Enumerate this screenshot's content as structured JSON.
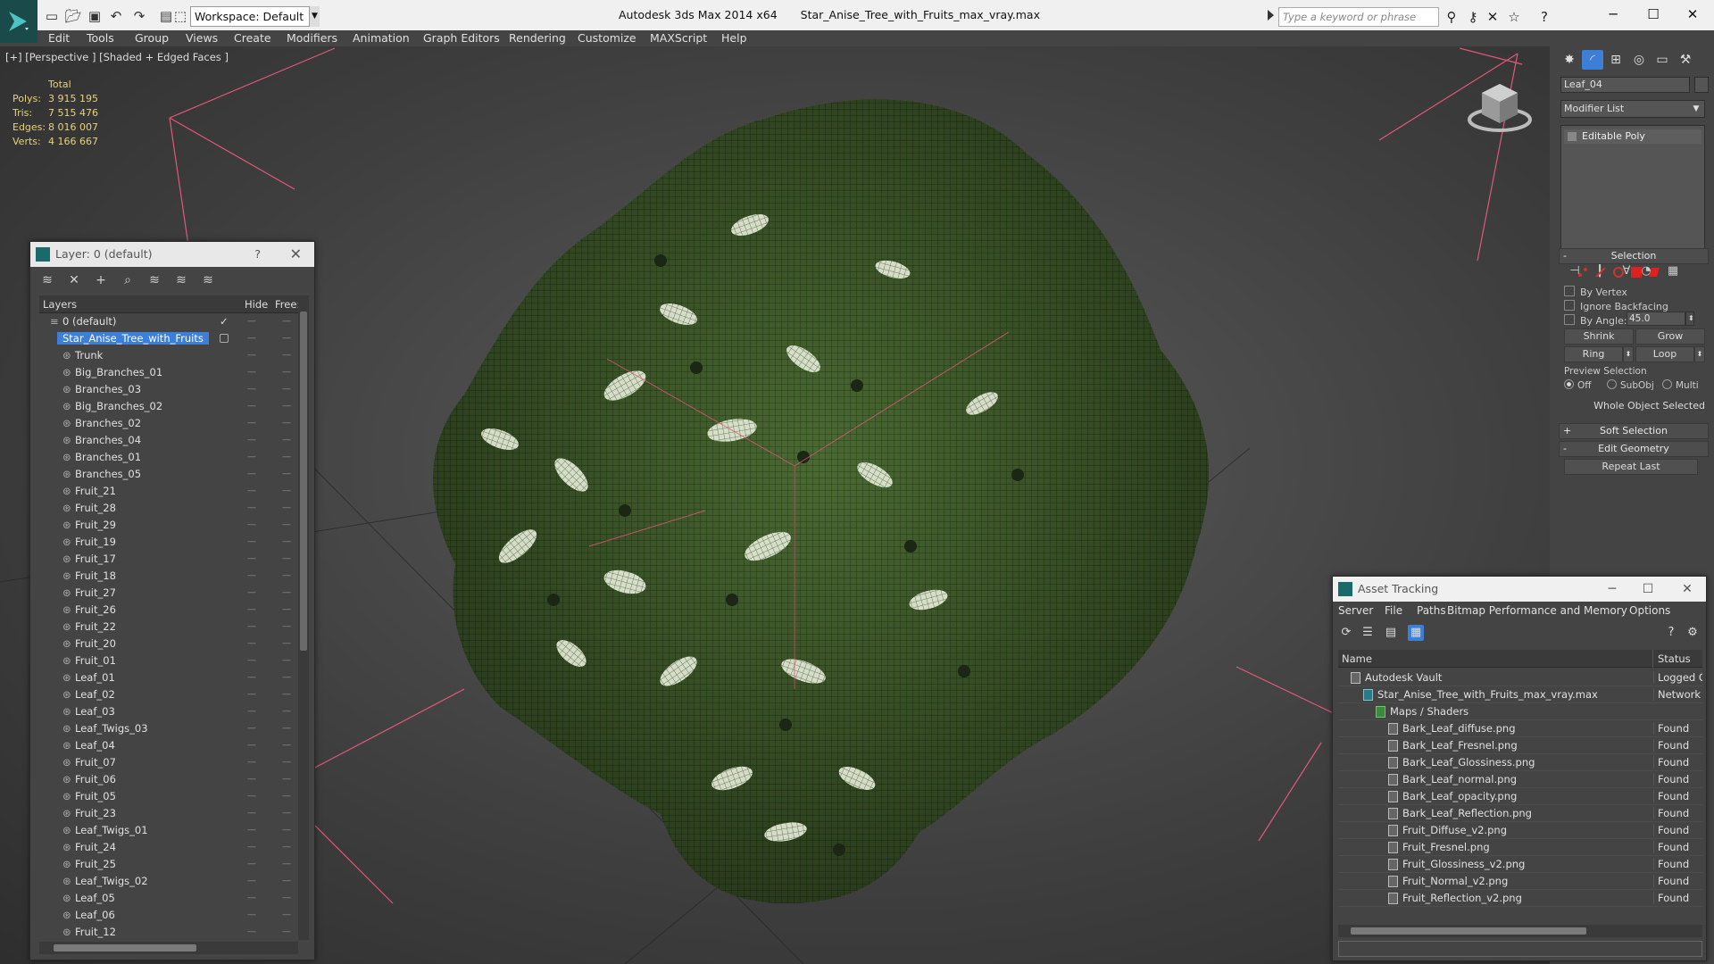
{
  "titlebar": {
    "workspace": "Workspace: Default",
    "app_name": "Autodesk 3ds Max  2014 x64",
    "file_name": "Star_Anise_Tree_with_Fruits_max_vray.max",
    "search_placeholder": "Type a keyword or phrase"
  },
  "menu": [
    "Edit",
    "Tools",
    "Group",
    "Views",
    "Create",
    "Modifiers",
    "Animation",
    "Graph Editors",
    "Rendering",
    "Customize",
    "MAXScript",
    "Help"
  ],
  "viewport": {
    "label": "[+] [Perspective ] [Shaded + Edged Faces ]",
    "stats": {
      "header": "Total",
      "polys_label": "Polys:",
      "polys": "3 915 195",
      "tris_label": "Tris:",
      "tris": "7 515 476",
      "edges_label": "Edges:",
      "edges": "8 016 007",
      "verts_label": "Verts:",
      "verts": "4 166 667"
    }
  },
  "layer_dialog": {
    "title": "Layer: 0 (default)",
    "help": "?",
    "col_layers": "Layers",
    "col_hide": "Hide",
    "col_freeze": "Free:",
    "default_layer": "0 (default)",
    "selected_layer": "Star_Anise_Tree_with_Fruits",
    "objects": [
      "Trunk",
      "Big_Branches_01",
      "Branches_03",
      "Big_Branches_02",
      "Branches_02",
      "Branches_04",
      "Branches_01",
      "Branches_05",
      "Fruit_21",
      "Fruit_28",
      "Fruit_29",
      "Fruit_19",
      "Fruit_17",
      "Fruit_18",
      "Fruit_27",
      "Fruit_26",
      "Fruit_22",
      "Fruit_20",
      "Fruit_01",
      "Leaf_01",
      "Leaf_02",
      "Leaf_03",
      "Leaf_Twigs_03",
      "Leaf_04",
      "Fruit_07",
      "Fruit_06",
      "Fruit_05",
      "Fruit_23",
      "Leaf_Twigs_01",
      "Fruit_24",
      "Fruit_25",
      "Leaf_Twigs_02",
      "Leaf_05",
      "Leaf_06",
      "Fruit_12"
    ]
  },
  "command_panel": {
    "object_name": "Leaf_04",
    "modifier_list": "Modifier List",
    "stack_item": "Editable Poly",
    "selection_title": "Selection",
    "by_vertex": "By Vertex",
    "ignore_backfacing": "Ignore Backfacing",
    "by_angle": "By Angle:",
    "angle_value": "45.0",
    "shrink": "Shrink",
    "grow": "Grow",
    "ring": "Ring",
    "loop": "Loop",
    "preview_selection": "Preview Selection",
    "preview_off": "Off",
    "preview_subobj": "SubObj",
    "preview_multi": "Multi",
    "whole_object": "Whole Object Selected",
    "soft_selection": "Soft Selection",
    "edit_geometry": "Edit Geometry",
    "repeat_last": "Repeat Last",
    "plus": "+",
    "minus": "-"
  },
  "asset_dialog": {
    "title": "Asset Tracking",
    "menu": [
      "Server",
      "File",
      "Paths",
      "Bitmap Performance and Memory",
      "Options"
    ],
    "col_name": "Name",
    "col_status": "Status",
    "rows": [
      {
        "name": "Autodesk Vault",
        "status": "Logged Ou",
        "indent": 0
      },
      {
        "name": "Star_Anise_Tree_with_Fruits_max_vray.max",
        "status": "Network Pa",
        "indent": 1
      },
      {
        "name": "Maps / Shaders",
        "status": "",
        "indent": 2
      },
      {
        "name": "Bark_Leaf_diffuse.png",
        "status": "Found",
        "indent": 3
      },
      {
        "name": "Bark_Leaf_Fresnel.png",
        "status": "Found",
        "indent": 3
      },
      {
        "name": "Bark_Leaf_Glossiness.png",
        "status": "Found",
        "indent": 3
      },
      {
        "name": "Bark_Leaf_normal.png",
        "status": "Found",
        "indent": 3
      },
      {
        "name": "Bark_Leaf_opacity.png",
        "status": "Found",
        "indent": 3
      },
      {
        "name": "Bark_Leaf_Reflection.png",
        "status": "Found",
        "indent": 3
      },
      {
        "name": "Fruit_Diffuse_v2.png",
        "status": "Found",
        "indent": 3
      },
      {
        "name": "Fruit_Fresnel.png",
        "status": "Found",
        "indent": 3
      },
      {
        "name": "Fruit_Glossiness_v2.png",
        "status": "Found",
        "indent": 3
      },
      {
        "name": "Fruit_Normal_v2.png",
        "status": "Found",
        "indent": 3
      },
      {
        "name": "Fruit_Reflection_v2.png",
        "status": "Found",
        "indent": 3
      }
    ]
  },
  "colors": {
    "selection_blue": "#3d7fd6",
    "stats_yellow": "#e6d27a",
    "foliage_dark": "#3f5a2a",
    "foliage_light": "#cfd8bf",
    "box_lines": "#e0587a"
  }
}
